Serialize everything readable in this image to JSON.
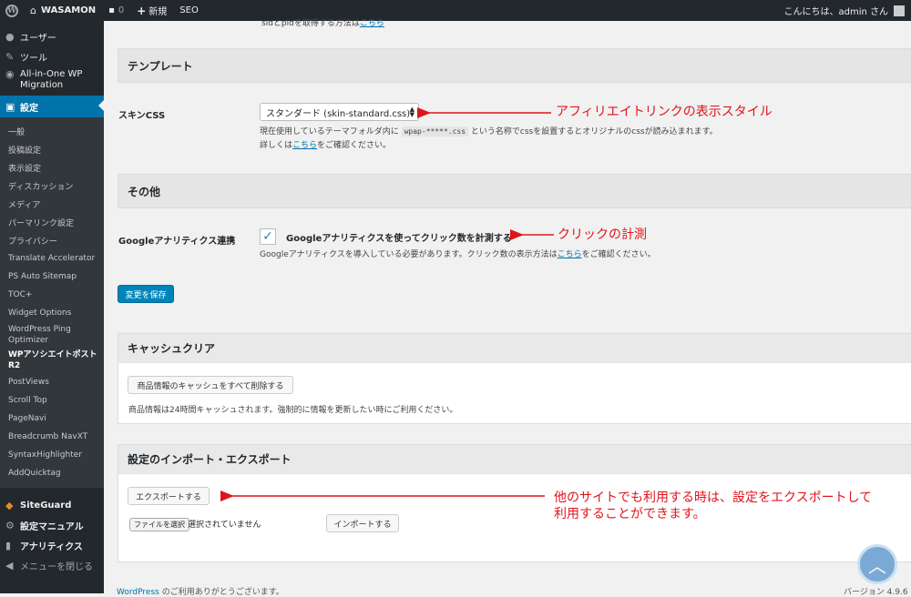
{
  "adminbar": {
    "site_name": "WASAMON",
    "comments_count": "0",
    "new_label": "新規",
    "seo_label": "SEO",
    "greeting": "こんにちは、admin さん"
  },
  "sidebar": {
    "items_top": [
      {
        "label": "ユーザー",
        "icon": "user-icon"
      },
      {
        "label": "ツール",
        "icon": "wrench-icon"
      },
      {
        "label": "All-in-One WP Migration",
        "icon": "migration-icon"
      }
    ],
    "current": {
      "label": "設定",
      "icon": "settings-icon"
    },
    "submenu": [
      "一般",
      "投稿設定",
      "表示設定",
      "ディスカッション",
      "メディア",
      "パーマリンク設定",
      "プライバシー",
      "Translate Accelerator",
      "PS Auto Sitemap",
      "TOC+",
      "Widget Options",
      "WordPress Ping Optimizer",
      "WPアソシエイトポスト R2",
      "PostViews",
      "Scroll Top",
      "PageNavi",
      "Breadcrumb NavXT",
      "SyntaxHighlighter",
      "AddQuicktag"
    ],
    "submenu_current": "WPアソシエイトポスト R2",
    "items_bottom": [
      {
        "label": "SiteGuard",
        "icon": "shield-icon"
      },
      {
        "label": "設定マニュアル",
        "icon": "gear-icon"
      },
      {
        "label": "アナリティクス",
        "icon": "chart-icon"
      },
      {
        "label": "メニューを閉じる",
        "icon": "collapse-icon"
      }
    ]
  },
  "main": {
    "top_note_pre": "sidとpidを取得する方法は",
    "top_note_link": "こちら",
    "top_note_post": "",
    "template_heading": "テンプレート",
    "skin_label": "スキンCSS",
    "skin_value": "スタンダード (skin-standard.css)",
    "skin_help_pre": "現在使用しているテーマフォルダ内に",
    "skin_help_code": "wpap-*****.css",
    "skin_help_post": "という名称でcssを設置するとオリジナルのcssが読み込まれます。",
    "skin_help2_pre": "詳しくは",
    "skin_help2_link": "こちら",
    "skin_help2_post": "をご確認ください。",
    "other_heading": "その他",
    "ga_label": "Googleアナリティクス連携",
    "ga_checkbox_label": "Googleアナリティクスを使ってクリック数を計測する",
    "ga_help_pre": "Googleアナリティクスを導入している必要があります。クリック数の表示方法は",
    "ga_help_link": "こちら",
    "ga_help_post": "をご確認ください。",
    "save_button": "変更を保存",
    "cache_heading": "キャッシュクリア",
    "cache_button": "商品情報のキャッシュをすべて削除する",
    "cache_help": "商品情報は24時間キャッシュされます。強制的に情報を更新したい時にご利用ください。",
    "ie_heading": "設定のインポート・エクスポート",
    "export_button": "エクスポートする",
    "file_button": "ファイルを選択",
    "file_status": "選択されていません",
    "import_button": "インポートする"
  },
  "annotations": {
    "skin": "アフィリエイトリンクの表示スタイル",
    "click": "クリックの計測",
    "export_line1": "他のサイトでも利用する時は、設定をエクスポートして",
    "export_line2": "利用することができます。"
  },
  "footer": {
    "thanks_link": "WordPress",
    "thanks_text": " のご利用ありがとうございます。",
    "version": "バージョン 4.9.6"
  },
  "colors": {
    "accent": "#0073aa",
    "annotation": "#e0141b",
    "adminbar": "#23282d"
  }
}
